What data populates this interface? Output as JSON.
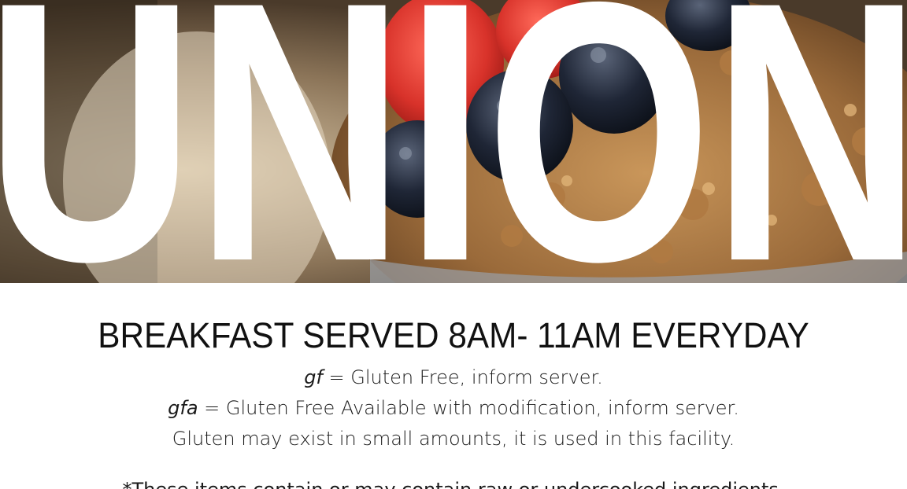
{
  "hero": {
    "wordmark": "UNION",
    "image_subject": "berries-and-granola-bowl-photo"
  },
  "headline": "BREAKFAST SERVED 8AM- 11AM EVERYDAY",
  "legend": {
    "gf_code": "gf",
    "gf_text": " = Gluten Free, inform server.",
    "gfa_code": "gfa",
    "gfa_text": " = Gluten Free Available with modification, inform server.",
    "gluten_note": "Gluten may exist in small amounts, it is used in this facility."
  },
  "notice": "*These items contain or may contain raw or undercooked ingredients.",
  "colors": {
    "wordmark": "#ffffff",
    "text": "#111111",
    "background": "#ffffff"
  }
}
